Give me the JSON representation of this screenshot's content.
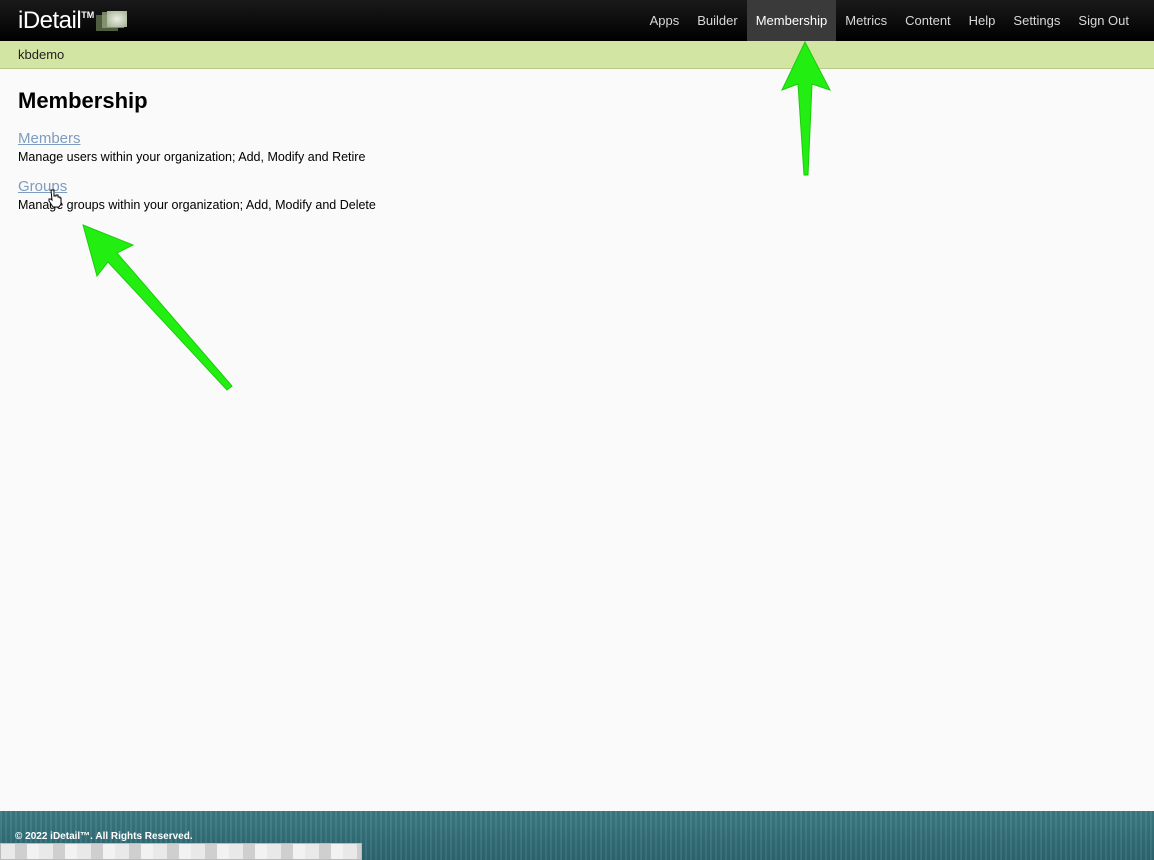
{
  "brand": {
    "name": "iDetail",
    "tm": "TM"
  },
  "nav": {
    "items": [
      {
        "label": "Apps"
      },
      {
        "label": "Builder"
      },
      {
        "label": "Membership",
        "active": true
      },
      {
        "label": "Metrics"
      },
      {
        "label": "Content"
      },
      {
        "label": "Help"
      },
      {
        "label": "Settings"
      },
      {
        "label": "Sign Out"
      }
    ]
  },
  "subbar": {
    "username": "kbdemo"
  },
  "page": {
    "title": "Membership",
    "items": [
      {
        "label": "Members",
        "description": "Manage users within your organization; Add, Modify and Retire"
      },
      {
        "label": "Groups",
        "description": "Manage groups within your organization; Add, Modify and Delete"
      }
    ]
  },
  "footer": {
    "copyright": "© 2022 iDetail™.  All Rights Reserved."
  },
  "colors": {
    "annotation_arrow": "#22ee11",
    "subbar": "#d3e5a3",
    "link": "#7d9cbf",
    "footer": "#2f6a73"
  },
  "icons": {
    "cursor": "hand-pointer-icon"
  }
}
